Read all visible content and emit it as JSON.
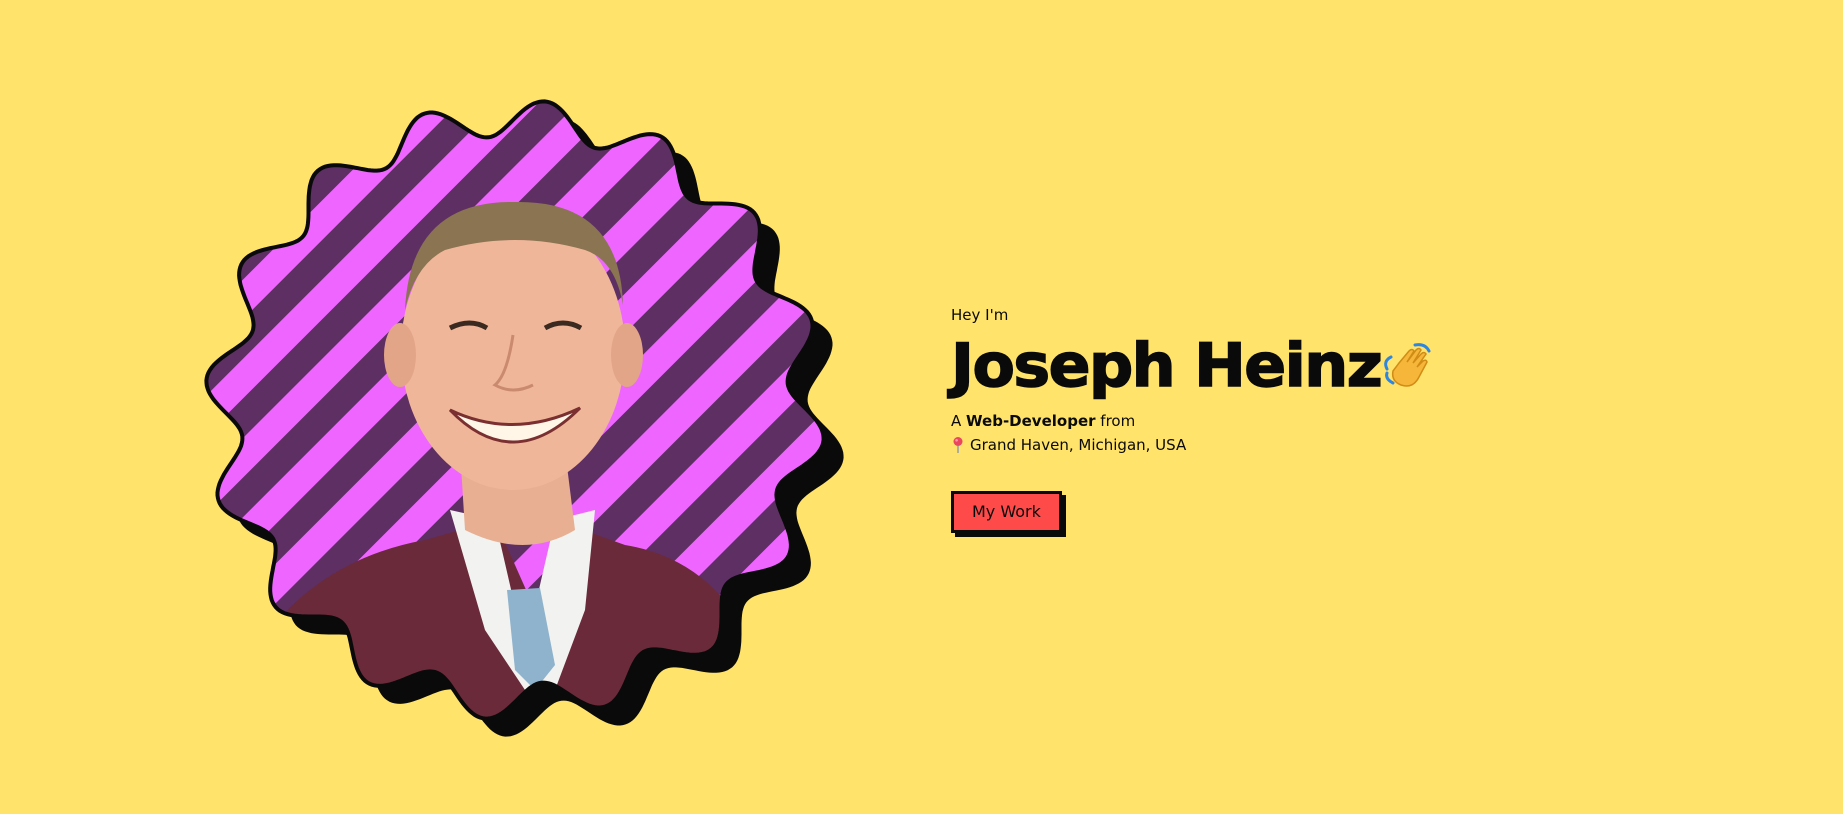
{
  "hero": {
    "greeting": "Hey I'm",
    "name": "Joseph Heinz",
    "wave_icon": "waving-hand-icon",
    "tagline_prefix": "A ",
    "tagline_role": "Web-Developer",
    "tagline_suffix": " from",
    "location_icon": "map-pin-icon",
    "location": "Grand Haven, Michigan, USA",
    "cta_label": "My Work"
  },
  "portrait": {
    "icon": "profile-photo"
  },
  "colors": {
    "background": "#FFE36A",
    "button": "#FF4A4A",
    "stripe_light": "#EE66FF",
    "stripe_dark": "#5E2F63",
    "outline": "#0A0A0A"
  }
}
